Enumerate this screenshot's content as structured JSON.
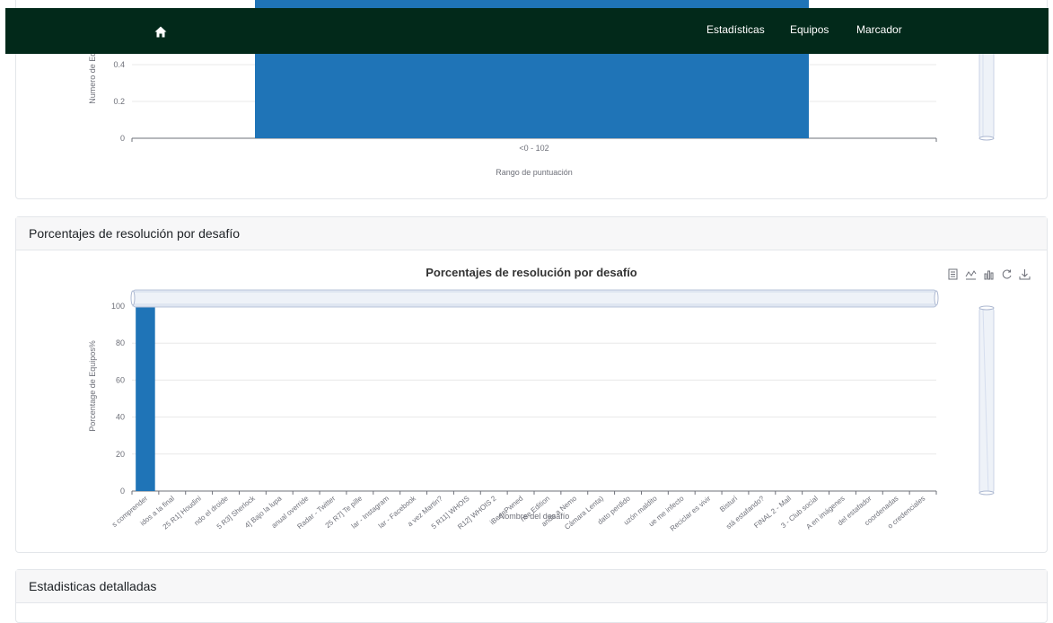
{
  "navbar": {
    "home_icon": "home-icon",
    "links": [
      "Estadísticas",
      "Equipos",
      "Marcador"
    ]
  },
  "score_chart": {
    "y_axis_label": "Numero de Equipos",
    "x_axis_label": "Rango de puntuación",
    "chart_data": {
      "type": "bar",
      "categories": [
        "<0 - 102"
      ],
      "values": [
        1
      ],
      "y_ticks_visible": [
        0,
        0.2,
        0.4
      ],
      "xlabel": "Rango de puntuación",
      "ylabel": "Numero de Equipos",
      "grid": true,
      "bar_color": "#1f74b7"
    }
  },
  "resolution_card": {
    "header": "Porcentajes de resolución por desafío",
    "chart_title": "Porcentajes de resolución por desafío",
    "toolbox_icons": [
      "data-view-icon",
      "line-chart-icon",
      "bar-chart-icon",
      "restore-icon",
      "download-icon"
    ],
    "chart_data": {
      "type": "bar",
      "title": "Porcentajes de resolución por desafío",
      "xlabel": "Nombre del desafío",
      "ylabel": "Porcentage de Equipos%",
      "ylim": [
        0,
        100
      ],
      "y_ticks": [
        0,
        20,
        40,
        60,
        80,
        100
      ],
      "grid": true,
      "bar_color": "#1f74b7",
      "categories": [
        "s comprender",
        "idos a la final",
        "25 R1] Houdini",
        "ndo el droide",
        "5 R3] Sherlock",
        "4] Bajo la lupa",
        "anual override",
        "Radar - Twitter",
        "25 R7] Te pille",
        "lar - Instagram",
        "lar - Facebook",
        "a vez Martin?",
        "5 R11] WHOIS",
        "R12] WHOIS 2",
        "iBeenPwned",
        "nse Edition",
        "ando a Nemo",
        "Cámara Lenta)",
        "dato perdido",
        "uzón maldito",
        "ue me infecto",
        "Reciclar es vivir",
        "Bisturí",
        "stá estafando?",
        "FINAL 2 - Mail",
        "3 - Club social",
        "A en imágenes",
        "del estafador",
        "coordenadas",
        "o credenciales"
      ],
      "values": [
        100,
        0,
        0,
        0,
        0,
        0,
        0,
        0,
        0,
        0,
        0,
        0,
        0,
        0,
        0,
        0,
        0,
        0,
        0,
        0,
        0,
        0,
        0,
        0,
        0,
        0,
        0,
        0,
        0,
        0
      ]
    }
  },
  "detailed_card": {
    "header": "Estadisticas detalladas"
  }
}
